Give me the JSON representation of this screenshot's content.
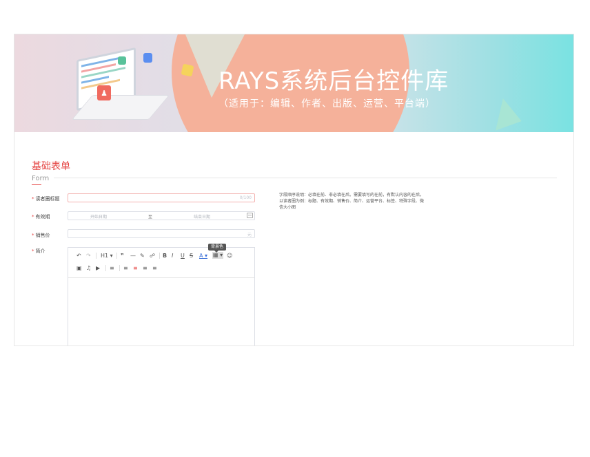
{
  "banner": {
    "title": "RAYS系统后台控件库",
    "subtitle": "（适用于：编辑、作者、出版、运营、平台端）"
  },
  "section": {
    "title": "基础表单",
    "subtitle": "Form"
  },
  "form": {
    "title_field": {
      "label": "读者圈标题",
      "counter": "0/100",
      "value": ""
    },
    "validity": {
      "label": "有效期",
      "start_placeholder": "开始日期",
      "separator": "至",
      "end_placeholder": "结束日期"
    },
    "price": {
      "label": "销售价",
      "unit": "元",
      "value": ""
    },
    "intro": {
      "label": "简介"
    }
  },
  "editor": {
    "tooltip": "背景色",
    "content": ""
  },
  "note": {
    "line1": "字段顺序说明：必填在前、非必填在后。需要填写的在前，有默认内容的在后。",
    "line2": "以读者圈为例：标题、有效期、销售价、简介、运营平台、标签、特殊字段、微信大小图"
  },
  "colors": {
    "accent": "#e4413f",
    "banner_circle": "#f5b19a",
    "banner_right": "#79e2e2"
  }
}
